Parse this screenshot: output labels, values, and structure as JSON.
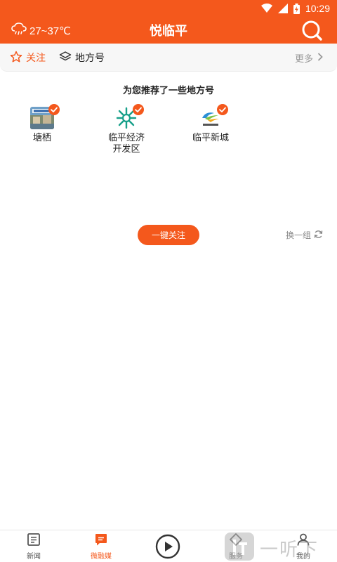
{
  "status_bar": {
    "time": "10:29"
  },
  "header": {
    "weather_text": "27~37℃",
    "title": "悦临平"
  },
  "tabs": {
    "follow_label": "关注",
    "local_label": "地方号",
    "more_label": "更多"
  },
  "recommend": {
    "title": "为您推荐了一些地方号",
    "items": [
      {
        "name": "塘栖"
      },
      {
        "name": "临平经济\n开发区"
      },
      {
        "name": "临平新城"
      }
    ],
    "follow_all_label": "一键关注",
    "refresh_label": "换一组"
  },
  "bottom_nav": {
    "items": [
      {
        "label": "新闻"
      },
      {
        "label": "微融媒"
      },
      {
        "label": "服务"
      },
      {
        "label": "我的"
      }
    ]
  },
  "watermark": {
    "text": "一听下载"
  },
  "colors": {
    "accent": "#f4581c",
    "muted": "#999999"
  }
}
